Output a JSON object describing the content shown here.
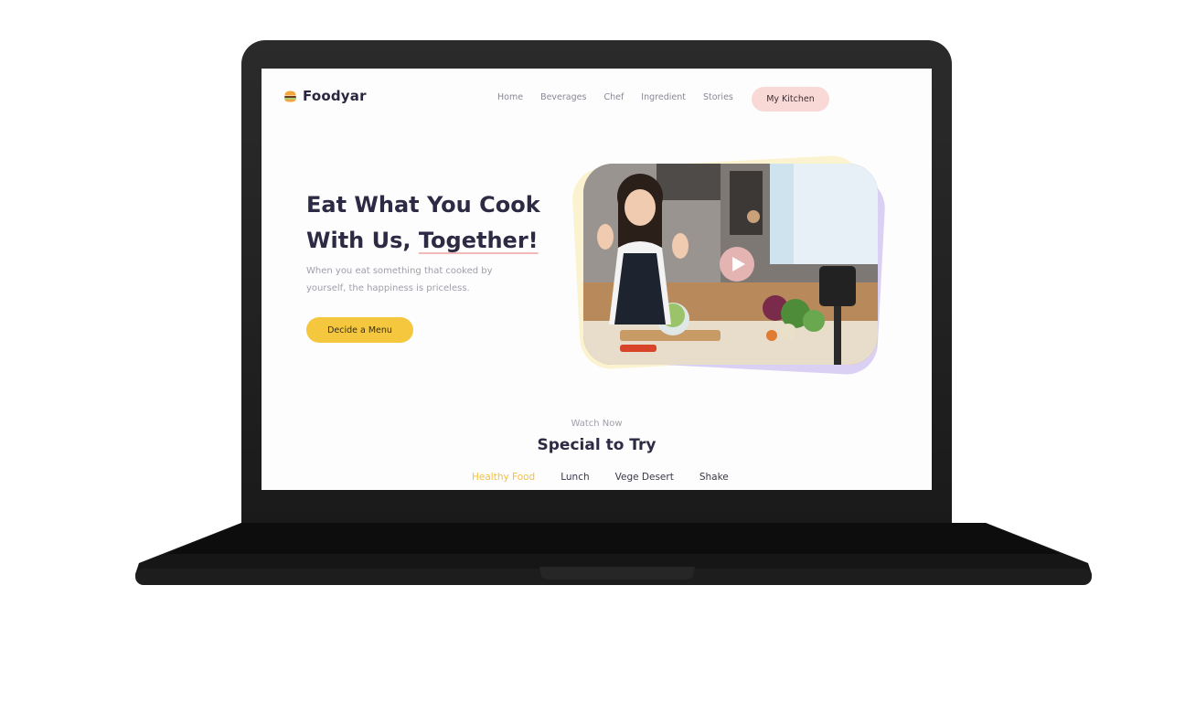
{
  "brand": {
    "name": "Foodyar",
    "icon": "burger-icon"
  },
  "nav": {
    "links": [
      "Home",
      "Beverages",
      "Chef",
      "Ingredient",
      "Stories"
    ],
    "cta_label": "My Kitchen"
  },
  "hero": {
    "title_line1": "Eat What You Cook",
    "title_line2_prefix": "With Us, ",
    "title_line2_highlight": "Together!",
    "subtitle": "When you eat something that cooked by yourself, the happiness is priceless.",
    "cta_label": "Decide a Menu",
    "video_icon": "play-icon"
  },
  "section": {
    "kicker": "Watch Now",
    "title": "Special to Try",
    "tabs": [
      "Healthy Food",
      "Lunch",
      "Vege Desert",
      "Shake"
    ],
    "active_tab": "Healthy Food"
  },
  "colors": {
    "accent_yellow": "#f4c73f",
    "accent_pink": "#f8d9d6",
    "heading": "#2d2a44",
    "muted": "#a19eaa"
  }
}
